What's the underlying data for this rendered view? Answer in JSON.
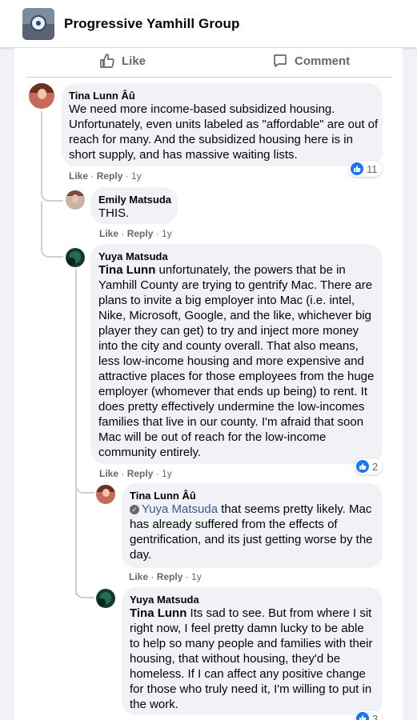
{
  "group": {
    "name": "Progressive Yamhill Group"
  },
  "post_actions": {
    "like_label": "Like",
    "comment_label": "Comment"
  },
  "comments": [
    {
      "author": "Tina Lunn Âû",
      "text": "We need more income-based subsidized housing. Unfortunately, even units labeled as \"affordable\" are out of reach for many. And the subsidized housing here is in short supply, and has massive waiting lists.",
      "like_label": "Like",
      "reply_label": "Reply",
      "time": "1y",
      "reactions": "11"
    },
    {
      "author": "Emily Matsuda",
      "text": "THIS.",
      "like_label": "Like",
      "reply_label": "Reply",
      "time": "1y"
    },
    {
      "author": "Yuya Matsuda",
      "mention": "Tina Lunn",
      "text": " unfortunately, the powers that be in Yamhill County are trying to gentrify Mac. There are plans to invite a big employer into Mac (i.e. intel, Nike, Microsoft, Google, and the like, whichever big player they can get) to try and inject more money into the city and county overall. That also means, less low-income housing and more expensive and attractive places for those employees from the huge employer (whomever that ends up being) to rent. It does pretty effectively undermine the low-incomes families that live in our county. I'm afraid that soon Mac will be out of reach for the low-income community entirely.",
      "like_label": "Like",
      "reply_label": "Reply",
      "time": "1y",
      "reactions": "2"
    },
    {
      "author": "Tina Lunn Âû",
      "mention": "Yuya Matsuda",
      "text": " that seems pretty likely. Mac has already suffered from the effects of gentrification, and its just getting worse by the day.",
      "like_label": "Like",
      "reply_label": "Reply",
      "time": "1y"
    },
    {
      "author": "Yuya Matsuda",
      "mention": "Tina Lunn",
      "text": " Its sad to see. But from where I sit right now, I feel pretty damn lucky to be able to help so many people and families with their housing, that without housing, they'd be homeless. If I can affect any positive change for those who truly need it, I'm willing to put in the work.",
      "reactions": "3"
    }
  ],
  "colors": {
    "accent": "#1877f2",
    "bubble": "#f0f2f5",
    "muted": "#65676b"
  }
}
